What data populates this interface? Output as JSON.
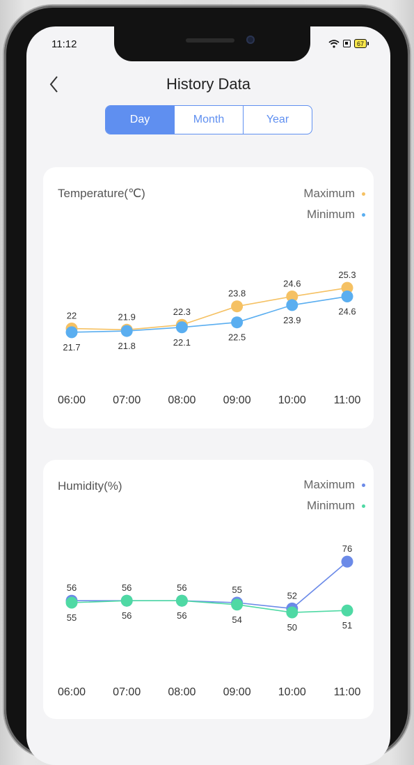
{
  "status_bar": {
    "time": "11:12",
    "battery": "67"
  },
  "header": {
    "title": "History Data"
  },
  "tabs": [
    "Day",
    "Month",
    "Year"
  ],
  "active_tab": "Day",
  "colors": {
    "accent": "#5f8ff0",
    "temp_max": "#f5c163",
    "temp_min": "#5aaef0",
    "hum_max": "#6b8ae8",
    "hum_min": "#4fd9a4"
  },
  "temperature": {
    "title": "Temperature(℃)",
    "legend_max": "Maximum",
    "legend_min": "Minimum"
  },
  "humidity": {
    "title": "Humidity(%)",
    "legend_max": "Maximum",
    "legend_min": "Minimum"
  },
  "chart_data": [
    {
      "type": "line",
      "x": [
        "06:00",
        "07:00",
        "08:00",
        "09:00",
        "10:00",
        "11:00"
      ],
      "series": [
        {
          "name": "Maximum",
          "values": [
            22,
            21.9,
            22.3,
            23.8,
            24.6,
            25.3
          ]
        },
        {
          "name": "Minimum",
          "values": [
            21.7,
            21.8,
            22.1,
            22.5,
            23.9,
            24.6
          ]
        }
      ],
      "title": "Temperature(℃)",
      "ylim": [
        17,
        30
      ],
      "grid": false,
      "legend": "top-right"
    },
    {
      "type": "line",
      "x": [
        "06:00",
        "07:00",
        "08:00",
        "09:00",
        "10:00",
        "11:00"
      ],
      "series": [
        {
          "name": "Maximum",
          "values": [
            56,
            56,
            56,
            55,
            52,
            76
          ]
        },
        {
          "name": "Minimum",
          "values": [
            55,
            56,
            56,
            54,
            50,
            51
          ]
        }
      ],
      "title": "Humidity(%)",
      "ylim": [
        14,
        96
      ],
      "grid": false,
      "legend": "top-right"
    }
  ]
}
